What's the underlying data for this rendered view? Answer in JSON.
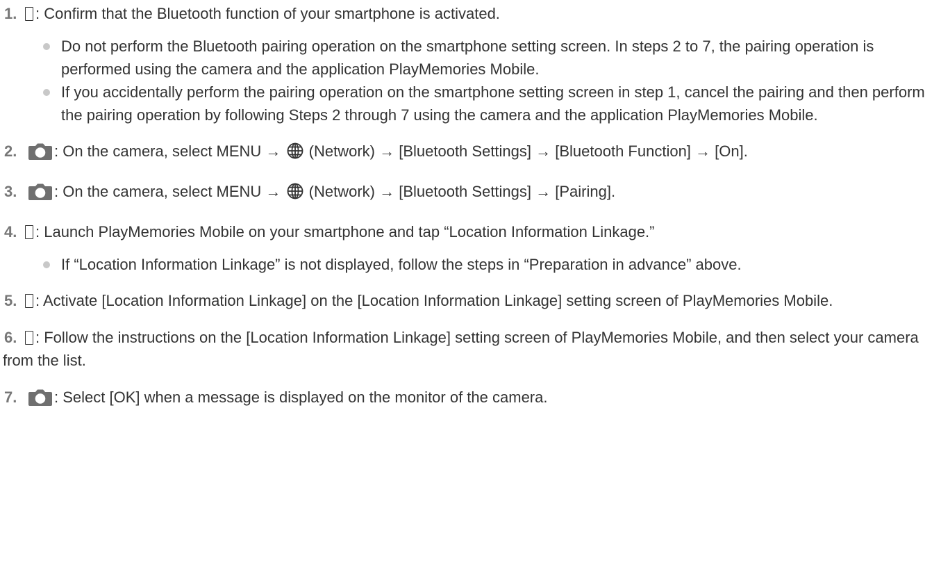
{
  "steps": [
    {
      "number": "1.",
      "device": "phone-icon",
      "text": ": Confirm that the Bluetooth function of your smartphone is activated.",
      "notes": [
        "Do not perform the Bluetooth pairing operation on the smartphone setting screen. In steps 2 to 7, the pairing operation is performed using the camera and the application PlayMemories Mobile.",
        "If you accidentally perform the pairing operation on the smartphone setting screen in step 1, cancel the pairing and then perform the pairing operation by following Steps 2 through 7 using the camera and the application PlayMemories Mobile."
      ]
    },
    {
      "number": "2.",
      "device": "camera-icon",
      "text_before": ": On the camera, select MENU → ",
      "text_after": " (Network) → [Bluetooth Settings] → [Bluetooth Function] → [On]."
    },
    {
      "number": "3.",
      "device": "camera-icon",
      "text_before": ": On the camera, select MENU → ",
      "text_after": " (Network) → [Bluetooth Settings] → [Pairing]."
    },
    {
      "number": "4.",
      "device": "phone-icon",
      "text": ": Launch PlayMemories Mobile on your smartphone and tap “Location Information Linkage.”",
      "notes": [
        "If “Location Information Linkage” is not displayed, follow the steps in “Preparation in advance” above."
      ]
    },
    {
      "number": "5.",
      "device": "phone-icon",
      "text": ": Activate [Location Information Linkage] on the [Location Information Linkage] setting screen of PlayMemories Mobile."
    },
    {
      "number": "6.",
      "device": "phone-icon",
      "text": ": Follow the instructions on the [Location Information Linkage] setting screen of PlayMemories Mobile, and then select your camera from the list."
    },
    {
      "number": "7.",
      "device": "camera-icon",
      "text": ": Select [OK] when a message is displayed on the monitor of the camera."
    }
  ],
  "colors": {
    "text": "#333333",
    "step_number": "#777777",
    "bullet": "#c8c8c8",
    "camera_icon": "#6f6f6f"
  },
  "icons": {
    "phone": "phone-icon",
    "camera": "camera-icon",
    "network": "globe-icon"
  }
}
